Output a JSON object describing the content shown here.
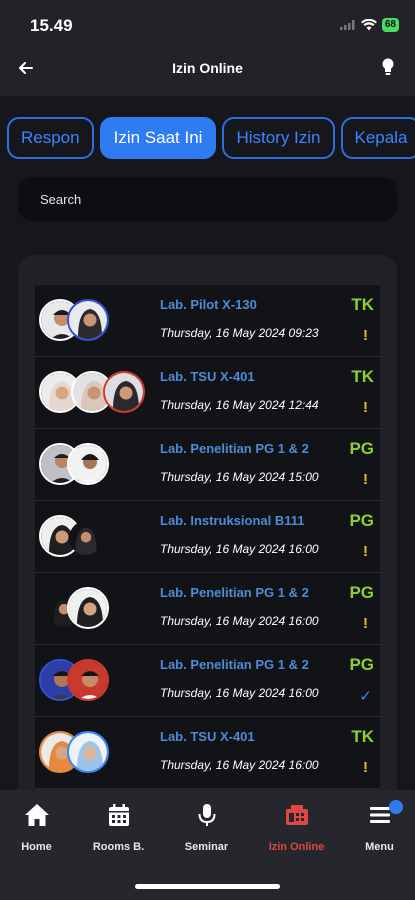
{
  "status": {
    "time": "15.49",
    "battery": "68"
  },
  "header": {
    "title": "Izin Online"
  },
  "tabs": [
    {
      "label": "Respon",
      "active": false
    },
    {
      "label": "Izin Saat Ini",
      "active": true
    },
    {
      "label": "History Izin",
      "active": false
    },
    {
      "label": "Kepala",
      "active": false
    }
  ],
  "search": {
    "placeholder": "Search"
  },
  "items": [
    {
      "room": "Lab. Pilot X-130",
      "date": "Thursday, 16 May 2024 09:23",
      "code": "TK",
      "status": "!"
    },
    {
      "room": "Lab. TSU X-401",
      "date": "Thursday, 16 May 2024 12:44",
      "code": "TK",
      "status": "!"
    },
    {
      "room": "Lab. Penelitian PG 1 & 2",
      "date": "Thursday, 16 May 2024 15:00",
      "code": "PG",
      "status": "!"
    },
    {
      "room": "Lab. Instruksional B111",
      "date": "Thursday, 16 May 2024 16:00",
      "code": "PG",
      "status": "!"
    },
    {
      "room": "Lab. Penelitian PG 1 & 2",
      "date": "Thursday, 16 May 2024 16:00",
      "code": "PG",
      "status": "!"
    },
    {
      "room": "Lab. Penelitian PG 1 & 2",
      "date": "Thursday, 16 May 2024 16:00",
      "code": "PG",
      "status": "✓"
    },
    {
      "room": "Lab. TSU X-401",
      "date": "Thursday, 16 May 2024 16:00",
      "code": "TK",
      "status": "!"
    }
  ],
  "nav": [
    {
      "label": "Home",
      "icon": "home-icon"
    },
    {
      "label": "Rooms B.",
      "icon": "calendar-icon"
    },
    {
      "label": "Seminar",
      "icon": "microphone-icon"
    },
    {
      "label": "Izin Online",
      "icon": "fax-icon",
      "active": true
    },
    {
      "label": "Menu",
      "icon": "menu-icon"
    }
  ],
  "colors": {
    "accent": "#2f7bf1",
    "room": "#4e8bd6",
    "code": "#8bd12c",
    "pending": "#f4c20d",
    "active_nav": "#e04646"
  }
}
